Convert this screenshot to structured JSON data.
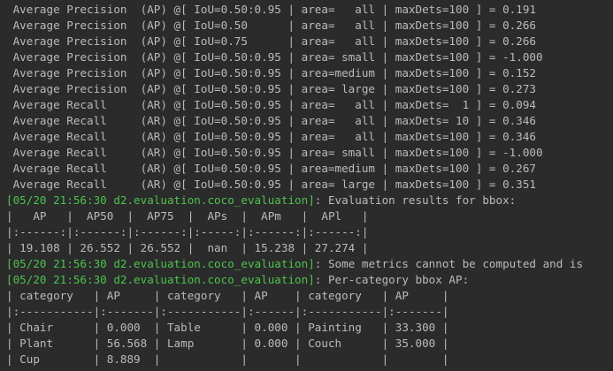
{
  "colors": {
    "background": "#2b2b2b",
    "text": "#bbbbbb",
    "log_prefix": "#4ec24e"
  },
  "console": {
    "lines": [
      {
        "prefix": "",
        "text": " Average Precision  (AP) @[ IoU=0.50:0.95 | area=   all | maxDets=100 ] = 0.191"
      },
      {
        "prefix": "",
        "text": " Average Precision  (AP) @[ IoU=0.50      | area=   all | maxDets=100 ] = 0.266"
      },
      {
        "prefix": "",
        "text": " Average Precision  (AP) @[ IoU=0.75      | area=   all | maxDets=100 ] = 0.266"
      },
      {
        "prefix": "",
        "text": " Average Precision  (AP) @[ IoU=0.50:0.95 | area= small | maxDets=100 ] = -1.000"
      },
      {
        "prefix": "",
        "text": " Average Precision  (AP) @[ IoU=0.50:0.95 | area=medium | maxDets=100 ] = 0.152"
      },
      {
        "prefix": "",
        "text": " Average Precision  (AP) @[ IoU=0.50:0.95 | area= large | maxDets=100 ] = 0.273"
      },
      {
        "prefix": "",
        "text": " Average Recall     (AR) @[ IoU=0.50:0.95 | area=   all | maxDets=  1 ] = 0.094"
      },
      {
        "prefix": "",
        "text": " Average Recall     (AR) @[ IoU=0.50:0.95 | area=   all | maxDets= 10 ] = 0.346"
      },
      {
        "prefix": "",
        "text": " Average Recall     (AR) @[ IoU=0.50:0.95 | area=   all | maxDets=100 ] = 0.346"
      },
      {
        "prefix": "",
        "text": " Average Recall     (AR) @[ IoU=0.50:0.95 | area= small | maxDets=100 ] = -1.000"
      },
      {
        "prefix": "",
        "text": " Average Recall     (AR) @[ IoU=0.50:0.95 | area=medium | maxDets=100 ] = 0.267"
      },
      {
        "prefix": "",
        "text": " Average Recall     (AR) @[ IoU=0.50:0.95 | area= large | maxDets=100 ] = 0.351"
      },
      {
        "prefix": "[05/20 21:56:30 d2.evaluation.coco_evaluation]",
        "text": ": Evaluation results for bbox:"
      },
      {
        "prefix": "",
        "text": "|   AP   |  AP50  |  AP75  |  APs  |  APm   |  APl   |"
      },
      {
        "prefix": "",
        "text": "|:------:|:------:|:------:|:-----:|:------:|:------:|"
      },
      {
        "prefix": "",
        "text": "| 19.108 | 26.552 | 26.552 |  nan  | 15.238 | 27.274 |"
      },
      {
        "prefix": "[05/20 21:56:30 d2.evaluation.coco_evaluation]",
        "text": ": Some metrics cannot be computed and is"
      },
      {
        "prefix": "[05/20 21:56:30 d2.evaluation.coco_evaluation]",
        "text": ": Per-category bbox AP:"
      },
      {
        "prefix": "",
        "text": "| category   | AP     | category   | AP    | category   | AP     |"
      },
      {
        "prefix": "",
        "text": "|:-----------|:-------|:-----------|:------|:-----------|:-------|"
      },
      {
        "prefix": "",
        "text": "| Chair      | 0.000  | Table      | 0.000 | Painting   | 33.300 |"
      },
      {
        "prefix": "",
        "text": "| Plant      | 56.568 | Lamp       | 0.000 | Couch      | 35.000 |"
      },
      {
        "prefix": "",
        "text": "| Cup        | 8.889  |            |       |            |        |"
      }
    ]
  }
}
